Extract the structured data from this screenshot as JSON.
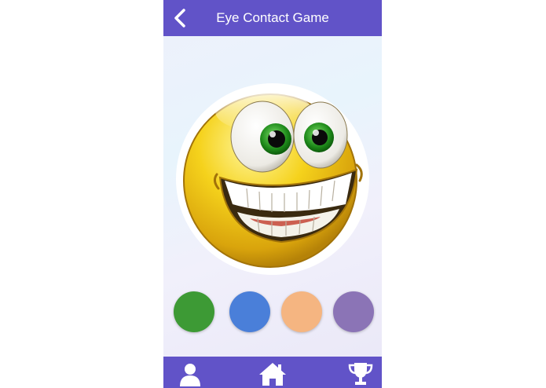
{
  "header": {
    "title": "Eye Contact Game",
    "back_icon": "back-chevron-icon"
  },
  "main": {
    "image": "smiling-emoji-face",
    "color_options": [
      {
        "name": "green",
        "color": "#3d9a35"
      },
      {
        "name": "blue",
        "color": "#4a7fd9"
      },
      {
        "name": "peach",
        "color": "#f5b581"
      },
      {
        "name": "purple",
        "color": "#8b74b6"
      }
    ]
  },
  "footer": {
    "nav": [
      {
        "icon": "person-icon"
      },
      {
        "icon": "home-icon"
      },
      {
        "icon": "trophy-icon"
      }
    ]
  },
  "theme": {
    "bar_color": "#6153c8"
  }
}
